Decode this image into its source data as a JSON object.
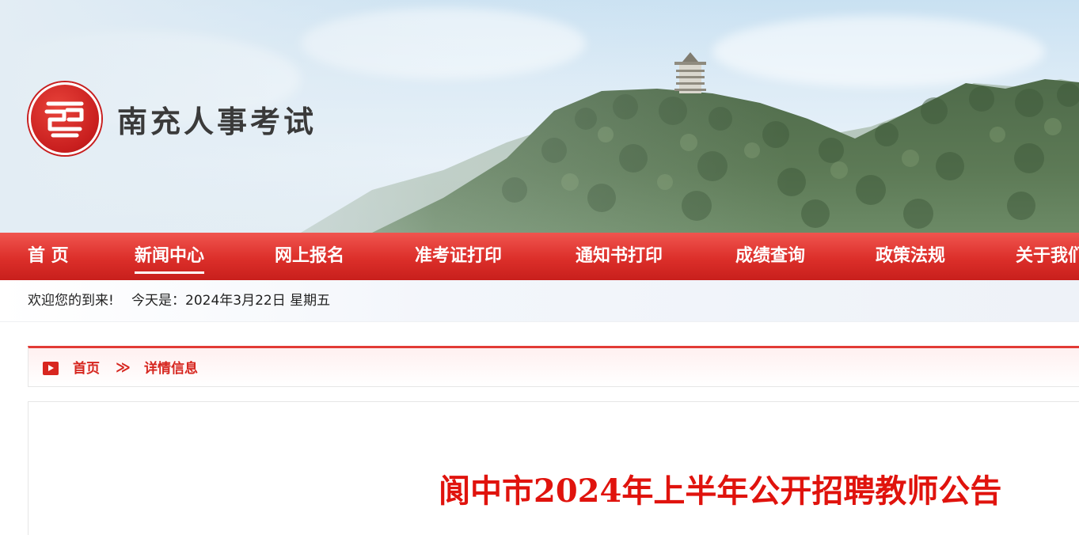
{
  "header": {
    "site_title": "南充人事考试",
    "logo_icon": "seal-logo-icon"
  },
  "nav": {
    "items": [
      {
        "label": "首 页",
        "active": false
      },
      {
        "label": "新闻中心",
        "active": true
      },
      {
        "label": "网上报名",
        "active": false
      },
      {
        "label": "准考证打印",
        "active": false
      },
      {
        "label": "通知书打印",
        "active": false
      },
      {
        "label": "成绩查询",
        "active": false
      },
      {
        "label": "政策法规",
        "active": false
      },
      {
        "label": "关于我们",
        "active": false
      }
    ]
  },
  "welcome": {
    "greeting": "欢迎您的到来!",
    "today": "今天是：2024年3月22日 星期五"
  },
  "breadcrumb": {
    "home": "首页",
    "separator": "≫",
    "current": "详情信息"
  },
  "article": {
    "title": "阆中市2024年上半年公开招聘教师公告"
  },
  "colors": {
    "brand_red": "#d8261f",
    "title_red": "#e0130d"
  }
}
